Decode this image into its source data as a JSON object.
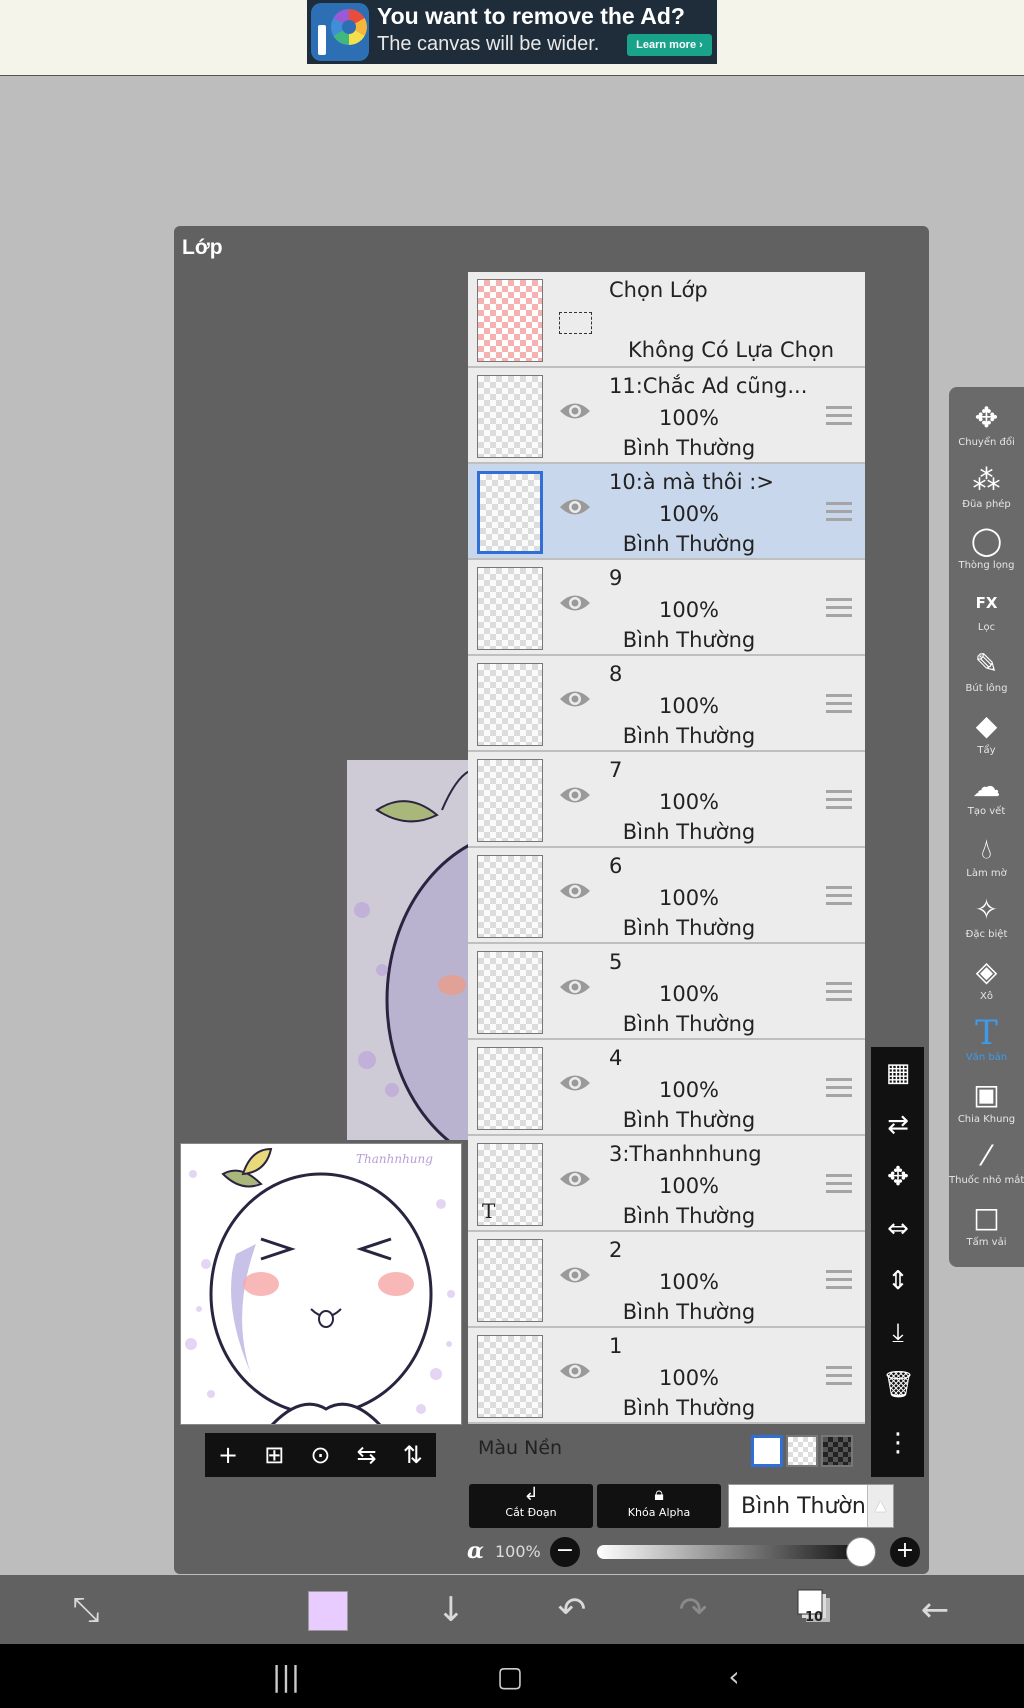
{
  "ad": {
    "title": "You want to remove the Ad?",
    "subtitle": "The canvas will be wider.",
    "button": "Learn more ›"
  },
  "panel": {
    "title": "Lớp"
  },
  "thumbnail": {
    "signature": "Thanhnhung"
  },
  "selection_row": {
    "title": "Chọn Lớp",
    "status": "Không Có Lựa Chọn"
  },
  "layers": [
    {
      "name": "11:Chắc Ad cũng...",
      "opacity": "100%",
      "blend": "Bình Thường",
      "selected": false
    },
    {
      "name": "10:à mà thôi :>",
      "opacity": "100%",
      "blend": "Bình Thường",
      "selected": true
    },
    {
      "name": "9",
      "opacity": "100%",
      "blend": "Bình Thường",
      "selected": false
    },
    {
      "name": "8",
      "opacity": "100%",
      "blend": "Bình Thường",
      "selected": false
    },
    {
      "name": "7",
      "opacity": "100%",
      "blend": "Bình Thường",
      "selected": false
    },
    {
      "name": "6",
      "opacity": "100%",
      "blend": "Bình Thường",
      "selected": false
    },
    {
      "name": "5",
      "opacity": "100%",
      "blend": "Bình Thường",
      "selected": false
    },
    {
      "name": "4",
      "opacity": "100%",
      "blend": "Bình Thường",
      "selected": false
    },
    {
      "name": "3:Thanhnhung",
      "opacity": "100%",
      "blend": "Bình Thường",
      "selected": false,
      "thumb_text": "T"
    },
    {
      "name": "2",
      "opacity": "100%",
      "blend": "Bình Thường",
      "selected": false
    },
    {
      "name": "1",
      "opacity": "100%",
      "blend": "Bình Thường",
      "selected": false
    }
  ],
  "background_row": {
    "label": "Màu Nền",
    "selected": "white"
  },
  "controls": {
    "clip_label": "Cắt Đoạn",
    "alpha_lock_label": "Khóa Alpha",
    "blend_mode": "Bình Thường",
    "alpha_symbol": "α",
    "opacity_value": "100%",
    "opacity_fraction": 1.0
  },
  "tools": [
    {
      "label": "Chuyển đổi",
      "icon": "move-icon"
    },
    {
      "label": "Đũa phép",
      "icon": "magic-wand-icon"
    },
    {
      "label": "Thòng lọng",
      "icon": "lasso-icon"
    },
    {
      "label": "Lọc",
      "icon": "fx-icon"
    },
    {
      "label": "Bút lông",
      "icon": "brush-icon"
    },
    {
      "label": "Tẩy",
      "icon": "eraser-icon"
    },
    {
      "label": "Tạo vết",
      "icon": "smudge-icon"
    },
    {
      "label": "Làm mờ",
      "icon": "blur-icon"
    },
    {
      "label": "Đặc biệt",
      "icon": "special-icon"
    },
    {
      "label": "Xô",
      "icon": "bucket-icon"
    },
    {
      "label": "Văn bản",
      "icon": "text-icon",
      "active": true
    },
    {
      "label": "Chia Khung",
      "icon": "frame-divider-icon"
    },
    {
      "label": "Thuốc nhỏ mắt",
      "icon": "eyedropper-icon"
    },
    {
      "label": "Tấm vải",
      "icon": "canvas-icon"
    }
  ],
  "bottom_bar": {
    "current_color": "#e8ccff",
    "layer_count": "10"
  },
  "colors": {
    "accent": "#2f6fd6",
    "active_tool": "#3d9be9",
    "panel": "#616161",
    "selected_row": "#c9d7ec"
  }
}
